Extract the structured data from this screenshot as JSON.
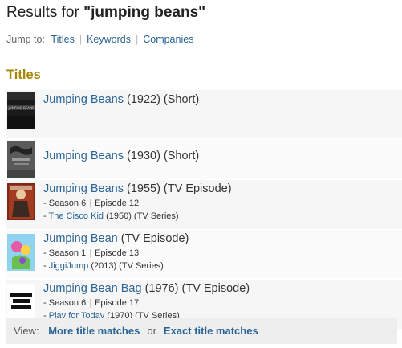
{
  "header": {
    "prefix": "Results for ",
    "query": "\"jumping beans\""
  },
  "jump_to": {
    "label": "Jump to:",
    "links": [
      "Titles",
      "Keywords",
      "Companies"
    ]
  },
  "section": {
    "title": "Titles"
  },
  "results": [
    {
      "title": "Jumping Beans",
      "meta": "(1922) (Short)",
      "thumb": "jumping-beans-1922-poster"
    },
    {
      "title": "Jumping Beans",
      "meta": "(1930) (Short)",
      "thumb": "jumping-beans-1930-poster"
    },
    {
      "title": "Jumping Beans",
      "meta": "(1955) (TV Episode)",
      "season": "Season 6",
      "episode": "Episode 12",
      "series_title": "The Cisco Kid",
      "series_meta": "(1950) (TV Series)",
      "thumb": "cisco-kid-poster"
    },
    {
      "title": "Jumping Bean",
      "meta": "(TV Episode)",
      "season": "Season 1",
      "episode": "Episode 13",
      "series_title": "JiggiJump",
      "series_meta": "(2013) (TV Series)",
      "thumb": "jiggijump-poster"
    },
    {
      "title": "Jumping Bean Bag",
      "meta": "(1976) (TV Episode)",
      "season": "Season 6",
      "episode": "Episode 17",
      "series_title": "Play for Today",
      "series_meta": "(1970) (TV Series)",
      "thumb": "play-for-today-logo"
    }
  ],
  "view_bar": {
    "label": "View:",
    "more_link": "More title matches",
    "or": "or",
    "exact_link": "Exact title matches"
  },
  "colors": {
    "link": "#2a6496",
    "section_title": "#a58500",
    "row_bg_odd": "#f6f6f6",
    "row_bg_even": "#fbfbfb",
    "view_bar_bg": "#eeeeee"
  }
}
